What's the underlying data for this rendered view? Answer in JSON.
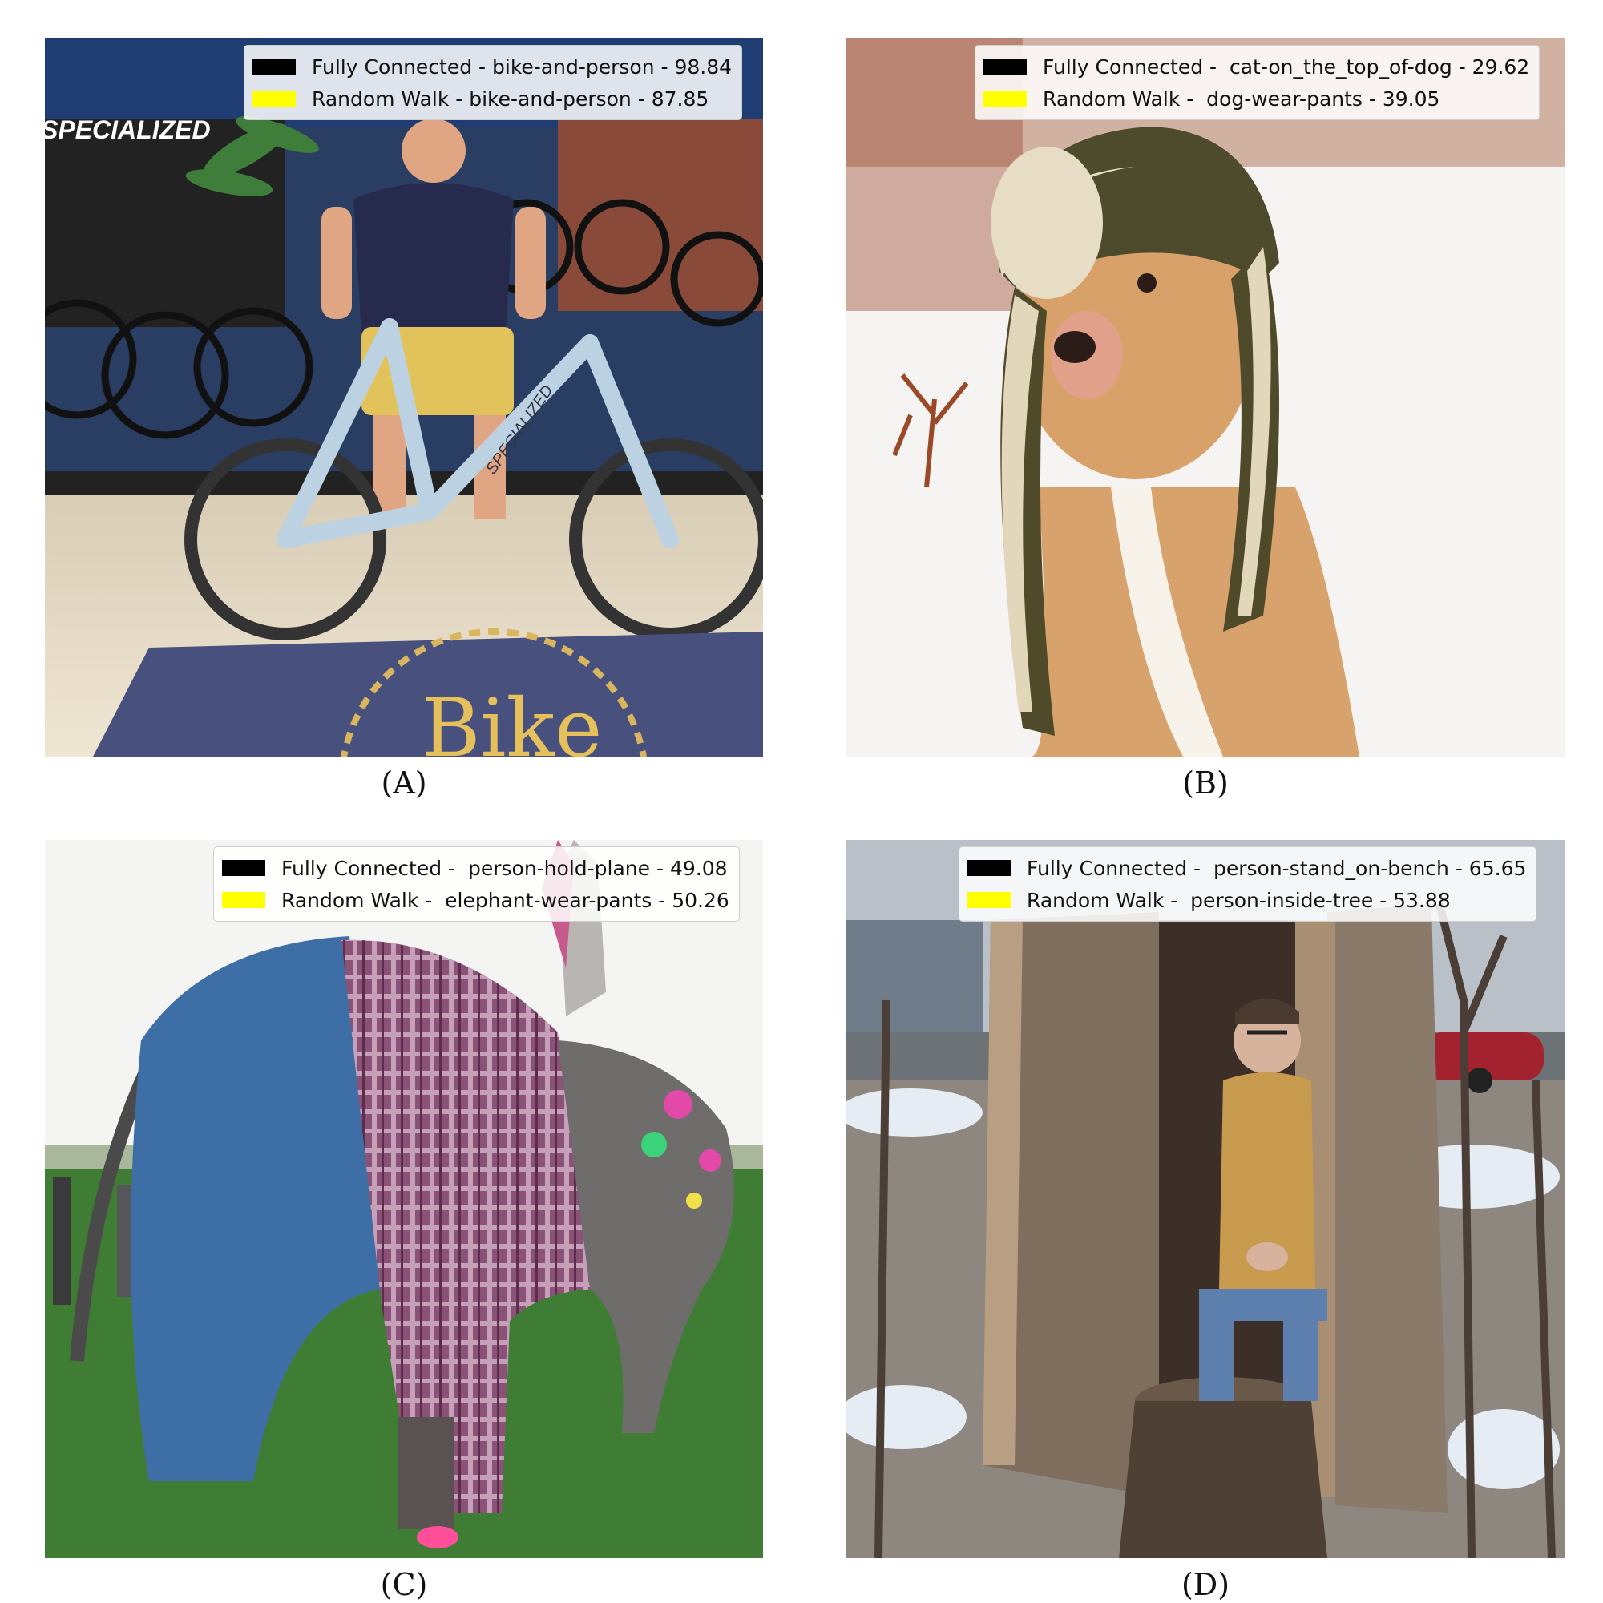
{
  "colors": {
    "fully_connected_swatch": "#000000",
    "random_walk_swatch": "#ffff00"
  },
  "panels": [
    {
      "caption": "(A)",
      "legend": {
        "fully_connected": "Fully Connected - bike-and-person - 98.84",
        "random_walk": "Random Walk - bike-and-person - 87.85"
      },
      "scene_text": {
        "store_sign": "SPECIALIZED",
        "frame_text": "SPECIALIZED",
        "mat_text": "Bike"
      }
    },
    {
      "caption": "(B)",
      "legend": {
        "fully_connected": "Fully Connected -  cat-on_the_top_of-dog - 29.62",
        "random_walk": "Random Walk -  dog-wear-pants - 39.05"
      }
    },
    {
      "caption": "(C)",
      "legend": {
        "fully_connected": "Fully Connected -  person-hold-plane - 49.08",
        "random_walk": "Random Walk -  elephant-wear-pants - 50.26"
      }
    },
    {
      "caption": "(D)",
      "legend": {
        "fully_connected": "Fully Connected -  person-stand_on-bench - 65.65",
        "random_walk": "Random Walk -  person-inside-tree - 53.88"
      }
    }
  ]
}
